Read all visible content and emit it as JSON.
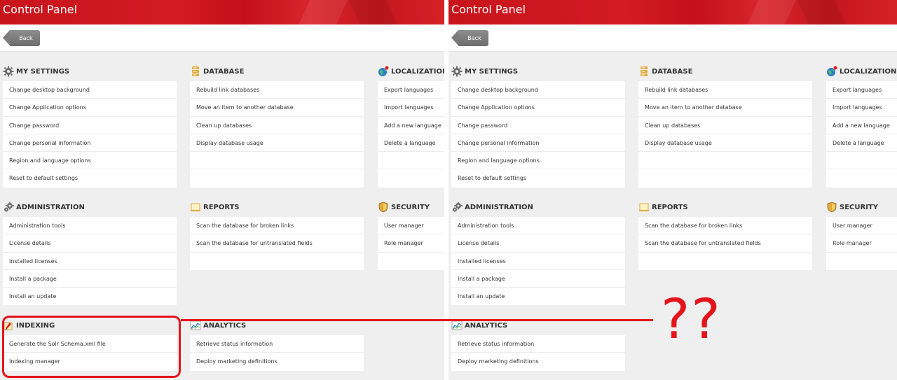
{
  "header": {
    "title": "Control Panel"
  },
  "toolbar": {
    "back_label": "Back"
  },
  "left": {
    "my_settings": {
      "title": "MY SETTINGS",
      "items": [
        "Change desktop background",
        "Change Application options",
        "Change password",
        "Change personal information",
        "Region and language options",
        "Reset to default settings"
      ]
    },
    "database": {
      "title": "DATABASE",
      "items": [
        "Rebuild link databases",
        "Move an item to another database",
        "Clean up databases",
        "Display database usage"
      ]
    },
    "localization": {
      "title": "LOCALIZATION",
      "items": [
        "Export languages",
        "Import languages",
        "Add a new language",
        "Delete a language"
      ]
    },
    "administration": {
      "title": "ADMINISTRATION",
      "items": [
        "Administration tools",
        "License details",
        "Installed licenses",
        "Install a package",
        "Install an update"
      ]
    },
    "reports": {
      "title": "REPORTS",
      "items": [
        "Scan the database for broken links",
        "Scan the database for untranslated fields"
      ]
    },
    "security": {
      "title": "SECURITY",
      "items": [
        "User manager",
        "Role manager"
      ]
    },
    "indexing": {
      "title": "INDEXING",
      "items": [
        "Generate the Solr Schema.xml file",
        "Indexing manager"
      ]
    },
    "analytics": {
      "title": "ANALYTICS",
      "items": [
        "Retrieve status information",
        "Deploy marketing definitions"
      ]
    }
  },
  "right": {
    "my_settings": {
      "title": "MY SETTINGS",
      "items": [
        "Change desktop background",
        "Change Application options",
        "Change password",
        "Change personal information",
        "Region and language options",
        "Reset to default settings"
      ]
    },
    "database": {
      "title": "DATABASE",
      "items": [
        "Rebuild link databases",
        "Move an item to another database",
        "Clean up databases",
        "Display database usage"
      ]
    },
    "localization": {
      "title": "LOCALIZATION",
      "items": [
        "Export languages",
        "Import languages",
        "Add a new language",
        "Delete a language"
      ]
    },
    "administration": {
      "title": "ADMINISTRATION",
      "items": [
        "Administration tools",
        "License details",
        "Installed licenses",
        "Install a package",
        "Install an update"
      ]
    },
    "reports": {
      "title": "REPORTS",
      "items": [
        "Scan the database for broken links",
        "Scan the database for untranslated fields"
      ]
    },
    "security": {
      "title": "SECURITY",
      "items": [
        "User manager",
        "Role manager"
      ]
    },
    "analytics": {
      "title": "ANALYTICS",
      "items": [
        "Retrieve status information",
        "Deploy marketing definitions"
      ]
    }
  },
  "annotation": {
    "text": "??",
    "color": "#e5141b"
  },
  "icons": {
    "my_settings": "gear-icon",
    "database": "database-icon",
    "localization": "globe-icon",
    "administration": "gears-icon",
    "reports": "report-icon",
    "security": "shield-icon",
    "indexing": "indexing-icon",
    "analytics": "chart-icon"
  }
}
